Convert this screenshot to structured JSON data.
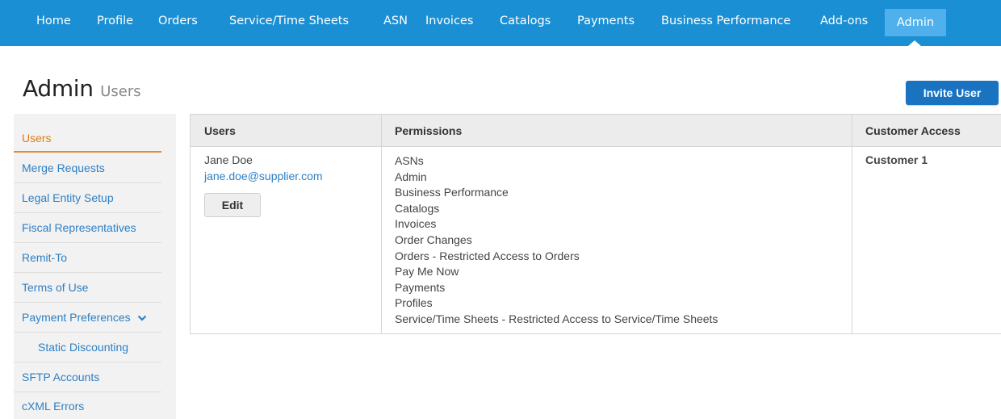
{
  "nav": {
    "items": [
      "Home",
      "Profile",
      "Orders",
      "Service/Time Sheets",
      "ASN",
      "Invoices",
      "Catalogs",
      "Payments",
      "Business Performance",
      "Add-ons",
      "Admin"
    ],
    "active": "Admin"
  },
  "header": {
    "title": "Admin",
    "subtitle": "Users",
    "invite_label": "Invite User"
  },
  "sidebar": {
    "items": [
      {
        "label": "Users"
      },
      {
        "label": "Merge Requests"
      },
      {
        "label": "Legal Entity Setup"
      },
      {
        "label": "Fiscal Representatives"
      },
      {
        "label": "Remit-To"
      },
      {
        "label": "Terms of Use"
      },
      {
        "label": "Payment Preferences"
      },
      {
        "label": "Static Discounting"
      },
      {
        "label": "SFTP Accounts"
      },
      {
        "label": "cXML Errors"
      }
    ]
  },
  "table": {
    "columns": [
      "Users",
      "Permissions",
      "Customer Access"
    ],
    "rows": [
      {
        "name": "Jane Doe",
        "email": "jane.doe@supplier.com",
        "edit_label": "Edit",
        "permissions": [
          "ASNs",
          "Admin",
          "Business Performance",
          "Catalogs",
          "Invoices",
          "Order Changes",
          "Orders - Restricted Access to Orders",
          "Pay Me Now",
          "Payments",
          "Profiles",
          "Service/Time Sheets - Restricted Access to Service/Time Sheets"
        ],
        "customer_access": "Customer 1"
      }
    ]
  },
  "colors": {
    "nav_bg": "#1a8fd4",
    "nav_active": "#4fb0ec",
    "link": "#2d7fc4",
    "active_side": "#e07a14",
    "primary_button": "#1a73c1"
  }
}
